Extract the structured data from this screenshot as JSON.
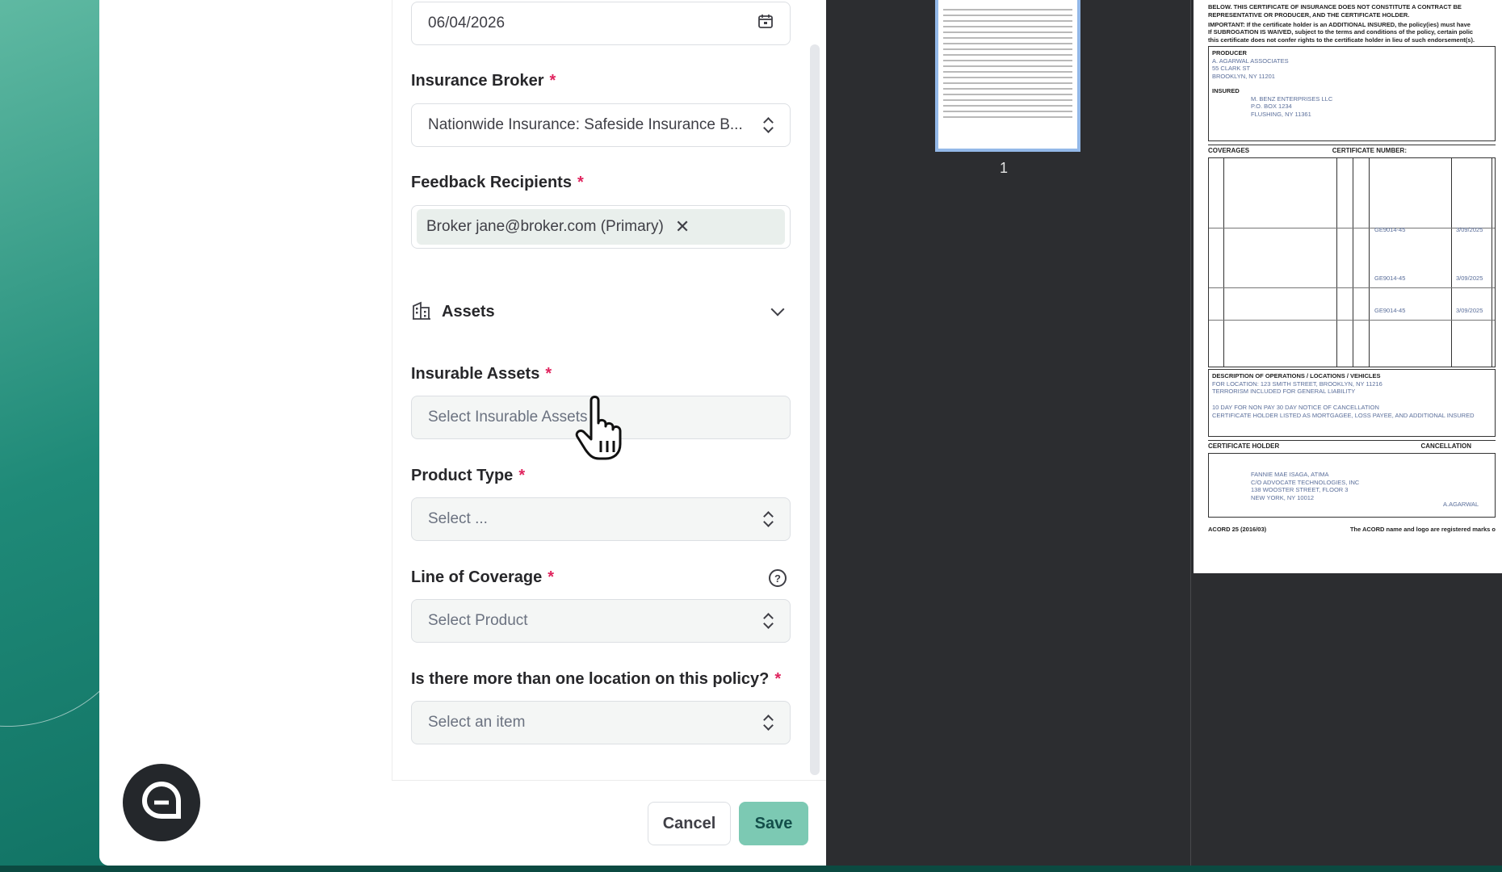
{
  "form": {
    "date_value": "06/04/2026",
    "broker": {
      "label": "Insurance Broker",
      "required": "*",
      "value": "Nationwide Insurance: Safeside Insurance B..."
    },
    "recipients": {
      "label": "Feedback Recipients",
      "required": "*",
      "chip": "Broker jane@broker.com (Primary)"
    },
    "assets_section": {
      "title": "Assets"
    },
    "insurable_assets": {
      "label": "Insurable Assets",
      "required": "*",
      "placeholder": "Select Insurable Assets"
    },
    "product_type": {
      "label": "Product Type",
      "required": "*",
      "placeholder": "Select ..."
    },
    "line_of_coverage": {
      "label": "Line of Coverage",
      "required": "*",
      "placeholder": "Select Product",
      "help": "?"
    },
    "multi_location": {
      "label": "Is there more than one location on this policy?",
      "required": "*",
      "placeholder": "Select an item"
    },
    "buttons": {
      "cancel": "Cancel",
      "save": "Save"
    }
  },
  "viewer": {
    "page_number": "1",
    "doc": {
      "top_text_1": "BELOW. THIS CERTIFICATE OF INSURANCE DOES NOT CONSTITUTE A CONTRACT BE",
      "top_text_2": "REPRESENTATIVE OR PRODUCER, AND THE CERTIFICATE HOLDER.",
      "important_1": "IMPORTANT: If the certificate holder is an ADDITIONAL INSURED, the policy(ies) must have",
      "important_2": "If SUBROGATION IS WAIVED, subject to the terms and conditions of the policy, certain polic",
      "important_3": "this certificate does not confer rights to the certificate holder in lieu of such endorsement(s).",
      "producer_label": "PRODUCER",
      "producer_1": "A. AGARWAL ASSOCIATES",
      "producer_2": "55 CLARK ST",
      "producer_3": "BROOKLYN, NY 11201",
      "insured_label": "INSURED",
      "insured_1": "M. BENZ ENTERPRISES LLC",
      "insured_2": "P.O. BOX 1234",
      "insured_3": "FLUSHING, NY 11361",
      "coverages": "COVERAGES",
      "cert_number": "CERTIFICATE NUMBER:",
      "policy_1": "GE9014-45",
      "date_1": "3/09/2025",
      "desc_label": "DESCRIPTION OF OPERATIONS / LOCATIONS / VEHICLES",
      "desc_1": "FOR LOCATION: 123 SMITH STREET, BROOKLYN, NY 11216",
      "desc_2": "TERRORISM INCLUDED FOR GENERAL LIABILITY",
      "desc_3": "10 DAY FOR NON PAY 30 DAY NOTICE OF CANCELLATION",
      "desc_4": "CERTIFICATE HOLDER LISTED AS MORTGAGEE, LOSS PAYEE, AND ADDITIONAL INSURED",
      "holder_label": "CERTIFICATE HOLDER",
      "cancel_label": "CANCELLATION",
      "holder_1": "FANNIE MAE ISAGA, ATIMA",
      "holder_2": "C/O ADVOCATE TECHNOLOGIES, INC",
      "holder_3": "138 WOOSTER STREET, FLOOR 3",
      "holder_4": "NEW YORK, NY 10012",
      "signer": "A.AGARWAL",
      "footer_left": "ACORD 25 (2016/03)",
      "footer_right": "The ACORD name and logo are registered marks o"
    }
  }
}
